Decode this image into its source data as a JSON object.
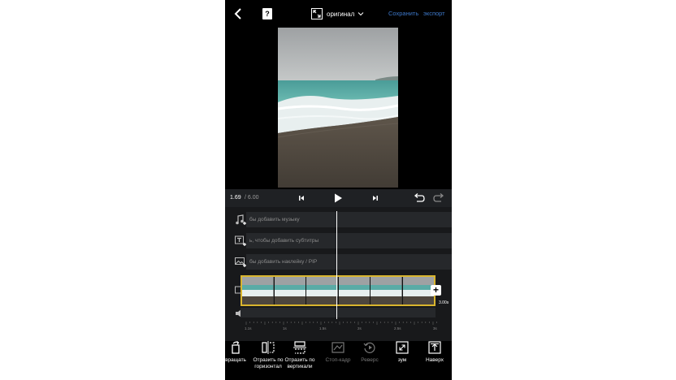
{
  "topbar": {
    "aspect_label": "оригинал",
    "save_label": "Сохранить",
    "export_label": "экспорт"
  },
  "playback": {
    "current_time": "1.69",
    "total_time": "/ 6.00"
  },
  "tracks": {
    "music_hint": "бы добавить музыку",
    "subtitles_hint": "ь, чтобы добавить субтитры",
    "sticker_hint": "бы добавить наклейку / PIP"
  },
  "clip": {
    "duration": "3.00s"
  },
  "ruler": {
    "labels": [
      "1.1s",
      "1s",
      "1.5s",
      "2s",
      "2.5s",
      "3s"
    ]
  },
  "tools": [
    {
      "label": "вращать",
      "icon": "rotate-icon",
      "enabled": true
    },
    {
      "label": "Отразить по горизонтал",
      "icon": "flip-horizontal-icon",
      "enabled": true
    },
    {
      "label": "Отразить по вертикали",
      "icon": "flip-vertical-icon",
      "enabled": true
    },
    {
      "label": "Стоп-кадр",
      "icon": "freeze-frame-icon",
      "enabled": false
    },
    {
      "label": "Реверс",
      "icon": "reverse-icon",
      "enabled": false
    },
    {
      "label": "зум",
      "icon": "zoom-icon",
      "enabled": true
    },
    {
      "label": "Наверх",
      "icon": "move-up-icon",
      "enabled": true
    }
  ],
  "colors": {
    "accent": "#3d78c9",
    "clip_border": "#d9b52e"
  }
}
